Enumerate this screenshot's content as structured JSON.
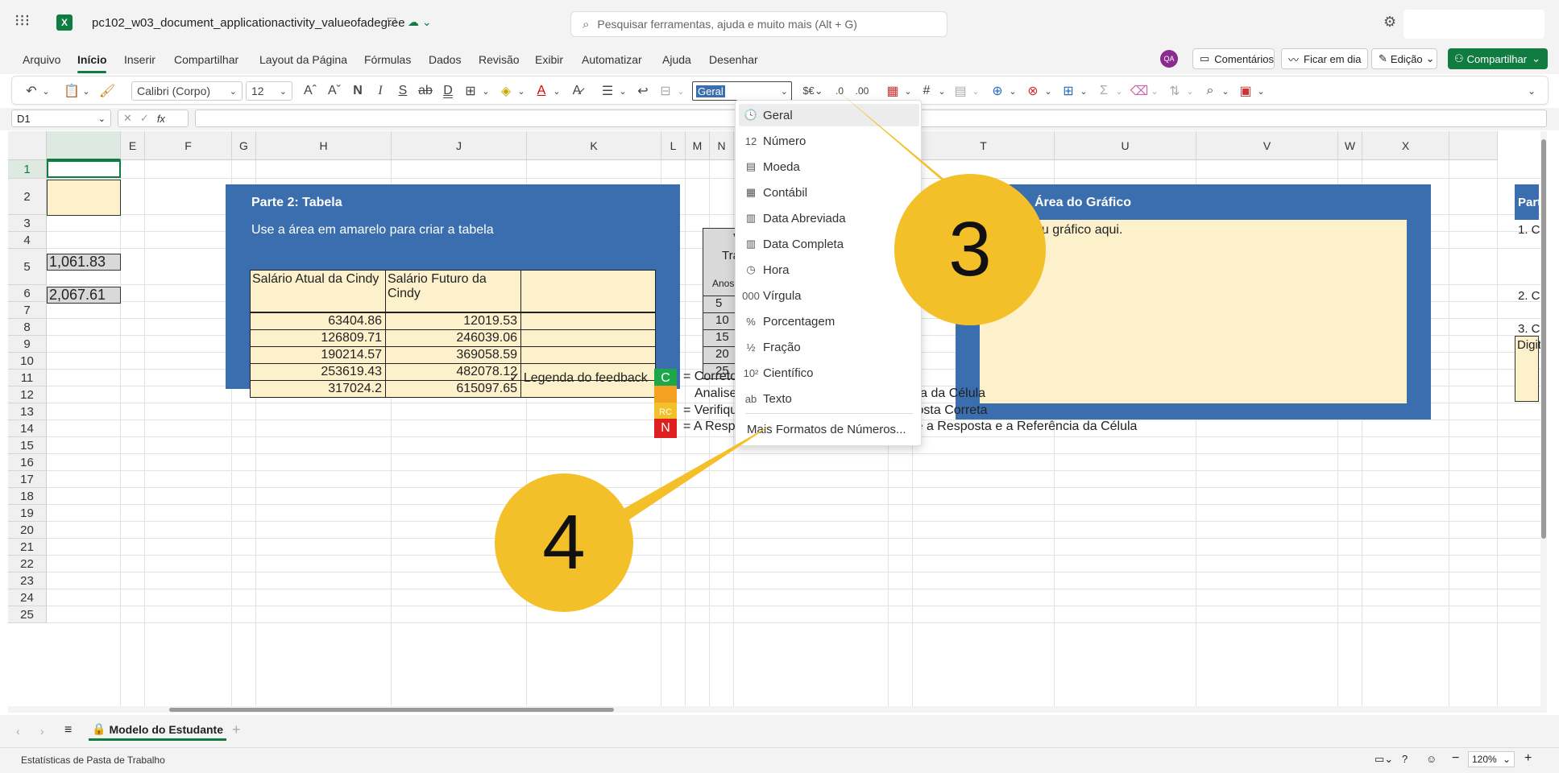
{
  "titlebar": {
    "filename": "pc102_w03_document_applicationactivity_valueofadegree",
    "search_placeholder": "Pesquisar ferramentas, ajuda e muito mais (Alt + G)"
  },
  "menu_tabs": [
    "Arquivo",
    "Início",
    "Inserir",
    "Compartilhar",
    "Layout da Página",
    "Fórmulas",
    "Dados",
    "Revisão",
    "Exibir",
    "Automatizar",
    "Ajuda",
    "Desenhar"
  ],
  "right_actions": {
    "avatar": "QA",
    "comments": "Comentários",
    "catchup": "Ficar em dia",
    "editing": "Edição",
    "share": "Compartilhar"
  },
  "ribbon": {
    "font_name": "Calibri (Corpo)",
    "font_size": "12",
    "bold": "N",
    "italic": "I",
    "underline": "S",
    "number_format": "Geral"
  },
  "formula_bar": {
    "name_box": "D1",
    "fx": "fx"
  },
  "columns": [
    {
      "label": "",
      "w": 92
    },
    {
      "label": "E",
      "w": 30
    },
    {
      "label": "F",
      "w": 108
    },
    {
      "label": "G",
      "w": 30
    },
    {
      "label": "H",
      "w": 168
    },
    {
      "label": "J",
      "w": 168
    },
    {
      "label": "K",
      "w": 167
    },
    {
      "label": "L",
      "w": 30
    },
    {
      "label": "M",
      "w": 30
    },
    {
      "label": "N",
      "w": 30
    },
    {
      "label": "",
      "w": 192
    },
    {
      "label": "S",
      "w": 30
    },
    {
      "label": "T",
      "w": 176
    },
    {
      "label": "U",
      "w": 176
    },
    {
      "label": "V",
      "w": 176
    },
    {
      "label": "W",
      "w": 30
    },
    {
      "label": "X",
      "w": 108
    },
    {
      "label": "",
      "w": 60
    }
  ],
  "rows": [
    "1",
    "2",
    "3",
    "4",
    "5",
    "6",
    "7",
    "8",
    "9",
    "10",
    "11",
    "12",
    "13",
    "14",
    "15",
    "16",
    "17",
    "18",
    "19",
    "20",
    "21",
    "22",
    "23",
    "24",
    "25"
  ],
  "cells": {
    "d6": "1,061.83",
    "d8": "2,067.61"
  },
  "part2": {
    "title": "Parte 2: Tabela",
    "subtitle": "Use a área em amarelo para criar a tabela",
    "header_current": "Salário Atual da Cindy",
    "header_future": "Salário Futuro da Cindy",
    "current": [
      "63404.86",
      "126809.71",
      "190214.57",
      "253619.43",
      "317024.2"
    ],
    "future": [
      "12019.53",
      "246039.06",
      "369058.59",
      "482078.12",
      "615097.65"
    ]
  },
  "partial_table": {
    "hdr_a": "V",
    "hdr_b": "Tra",
    "hdr_c": "Anos",
    "years": [
      "5",
      "10",
      "15",
      "20",
      "25"
    ]
  },
  "chart_panel": {
    "title": "Área do Gráfico",
    "placeholder": "eu gráfico aqui."
  },
  "right_panel": {
    "title": "Part",
    "q1": "1. C",
    "q2": "2. C",
    "q3": "3. C",
    "input": "Digit"
  },
  "legend": {
    "title": "✓ Legenda do feedback",
    "c_badge": "C",
    "c_text": "= Correto",
    "a_text": "Analise a Resposta, Corrija a Referência da Célula",
    "r_badge": "RC",
    "r_text": "= Verifique a Referência da Célula, Resposta Correta",
    "n_badge": "N",
    "n_text": "= A Resposta Não está Correta - Verifique a Resposta e a Referência da Célula"
  },
  "format_menu": {
    "items": [
      {
        "icon": "🕓",
        "label": "Geral"
      },
      {
        "icon": "12",
        "label": "Número"
      },
      {
        "icon": "▤",
        "label": "Moeda"
      },
      {
        "icon": "▦",
        "label": "Contábil"
      },
      {
        "icon": "▥",
        "label": "Data Abreviada"
      },
      {
        "icon": "▥",
        "label": "Data Completa"
      },
      {
        "icon": "◷",
        "label": "Hora"
      },
      {
        "icon": "000",
        "label": "Vírgula"
      },
      {
        "icon": "%",
        "label": "Porcentagem"
      },
      {
        "icon": "½",
        "label": "Fração"
      },
      {
        "icon": "10²",
        "label": "Científico"
      },
      {
        "icon": "ab",
        "label": "Texto"
      }
    ],
    "more": "Mais Formatos de Números..."
  },
  "callouts": {
    "three": "3",
    "four": "4"
  },
  "sheet_tab": "Modelo do Estudante",
  "status": {
    "left": "Estatísticas de Pasta de Trabalho",
    "zoom": "120%"
  },
  "colors": {
    "accent": "#107c41",
    "panel": "#3b6eae",
    "cream": "#fdf1cc",
    "callout": "#f4c02a"
  }
}
